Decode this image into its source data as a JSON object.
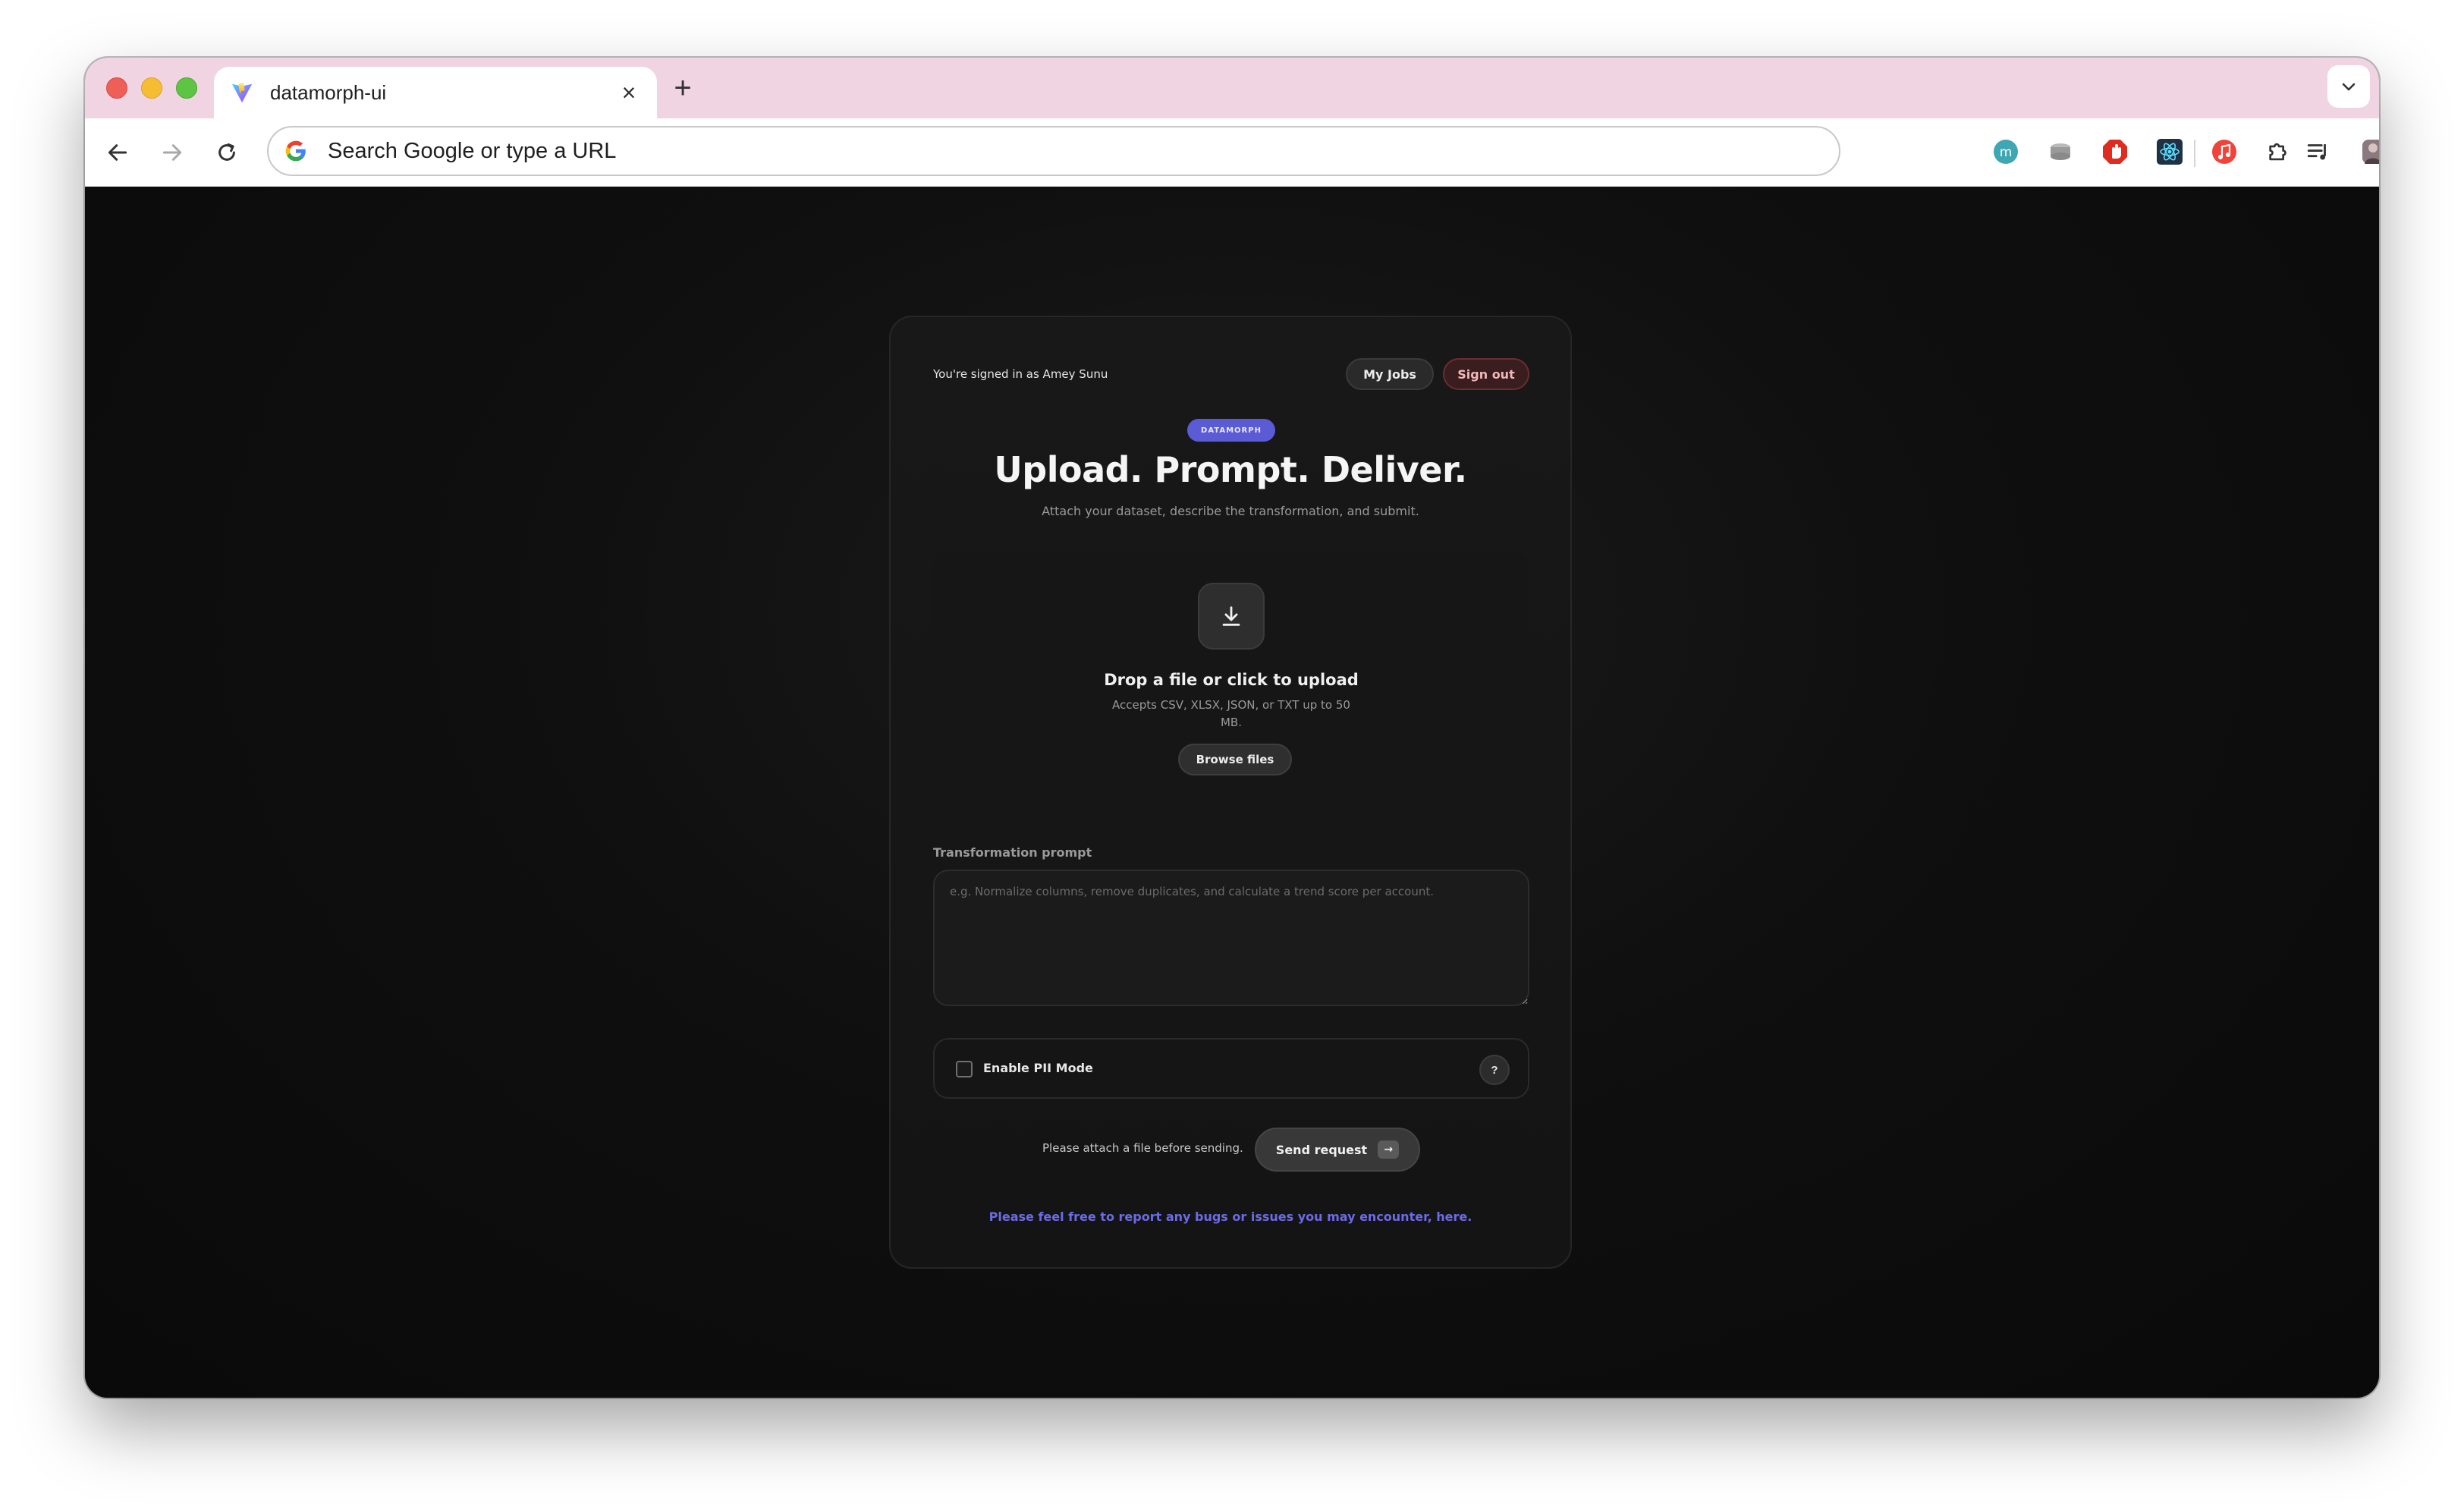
{
  "browser": {
    "tab_title": "datamorph-ui",
    "tab_close_glyph": "×",
    "new_tab_glyph": "+",
    "omnibox_placeholder": "Search Google or type a URL",
    "extension_icons": [
      "m-extension-icon",
      "disk-extension-icon",
      "adblock-extension-icon",
      "react-devtools-icon",
      "music-extension-icon",
      "puzzle-extensions-icon",
      "media-controls-icon",
      "profile-avatar",
      "kebab-menu-icon"
    ],
    "colors": {
      "tabstrip": "#f1d4e2",
      "red": "#ee5f57",
      "yellow": "#f6bd32",
      "green": "#5ec443"
    }
  },
  "page": {
    "signed_in_text": "You're signed in as Amey Sunu",
    "my_jobs_label": "My Jobs",
    "sign_out_label": "Sign out",
    "brand": "DATAMORPH",
    "headline": "Upload. Prompt. Deliver.",
    "subtitle": "Attach your dataset, describe the transformation, and submit.",
    "dropzone": {
      "title": "Drop a file or click to upload",
      "subtitle": "Accepts CSV, XLSX, JSON, or TXT up to 50 MB.",
      "browse_label": "Browse files"
    },
    "prompt": {
      "label": "Transformation prompt",
      "value": "",
      "placeholder": "e.g. Normalize columns, remove duplicates, and calculate a trend score per account."
    },
    "pii": {
      "label": "Enable PII Mode",
      "checked": false,
      "help_label": "?"
    },
    "send": {
      "hint": "Please attach a file before sending.",
      "label": "Send request",
      "arrow_glyph": "→"
    },
    "report_link": "Please feel free to report any bugs or issues you may encounter, here.",
    "colors": {
      "accent": "#5b5bd6",
      "link": "#6b6be8",
      "danger": "#f1b8ba",
      "background": "#0b0b0b"
    }
  }
}
